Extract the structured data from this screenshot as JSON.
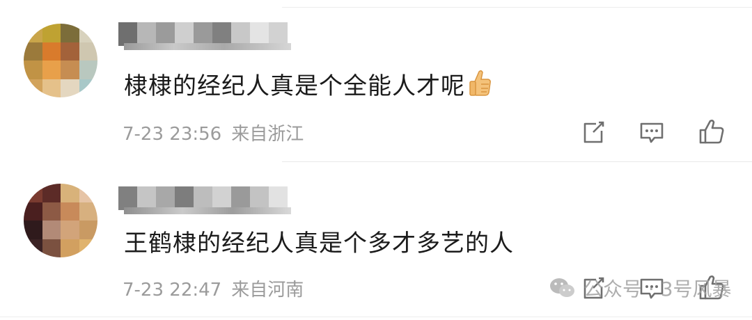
{
  "comments": [
    {
      "text": "棣棣的经纪人真是个全能人才呢",
      "emoji": "thumbs-up",
      "time": "7-23 23:56",
      "location": "来自浙江",
      "actions": [
        "share-icon",
        "reply-icon",
        "like-icon"
      ]
    },
    {
      "text": "王鹤棣的经纪人真是个多才多艺的人",
      "time": "7-23 22:47",
      "location": "来自河南",
      "actions": [
        "share-icon",
        "reply-icon",
        "like-icon"
      ]
    }
  ],
  "watermark": {
    "text": "公众号 · 3号风暴",
    "icon": "wechat-icon"
  },
  "colors": {
    "text": "#1b1b1b",
    "meta": "#9b9b9b",
    "icon": "#6f6f6f"
  }
}
